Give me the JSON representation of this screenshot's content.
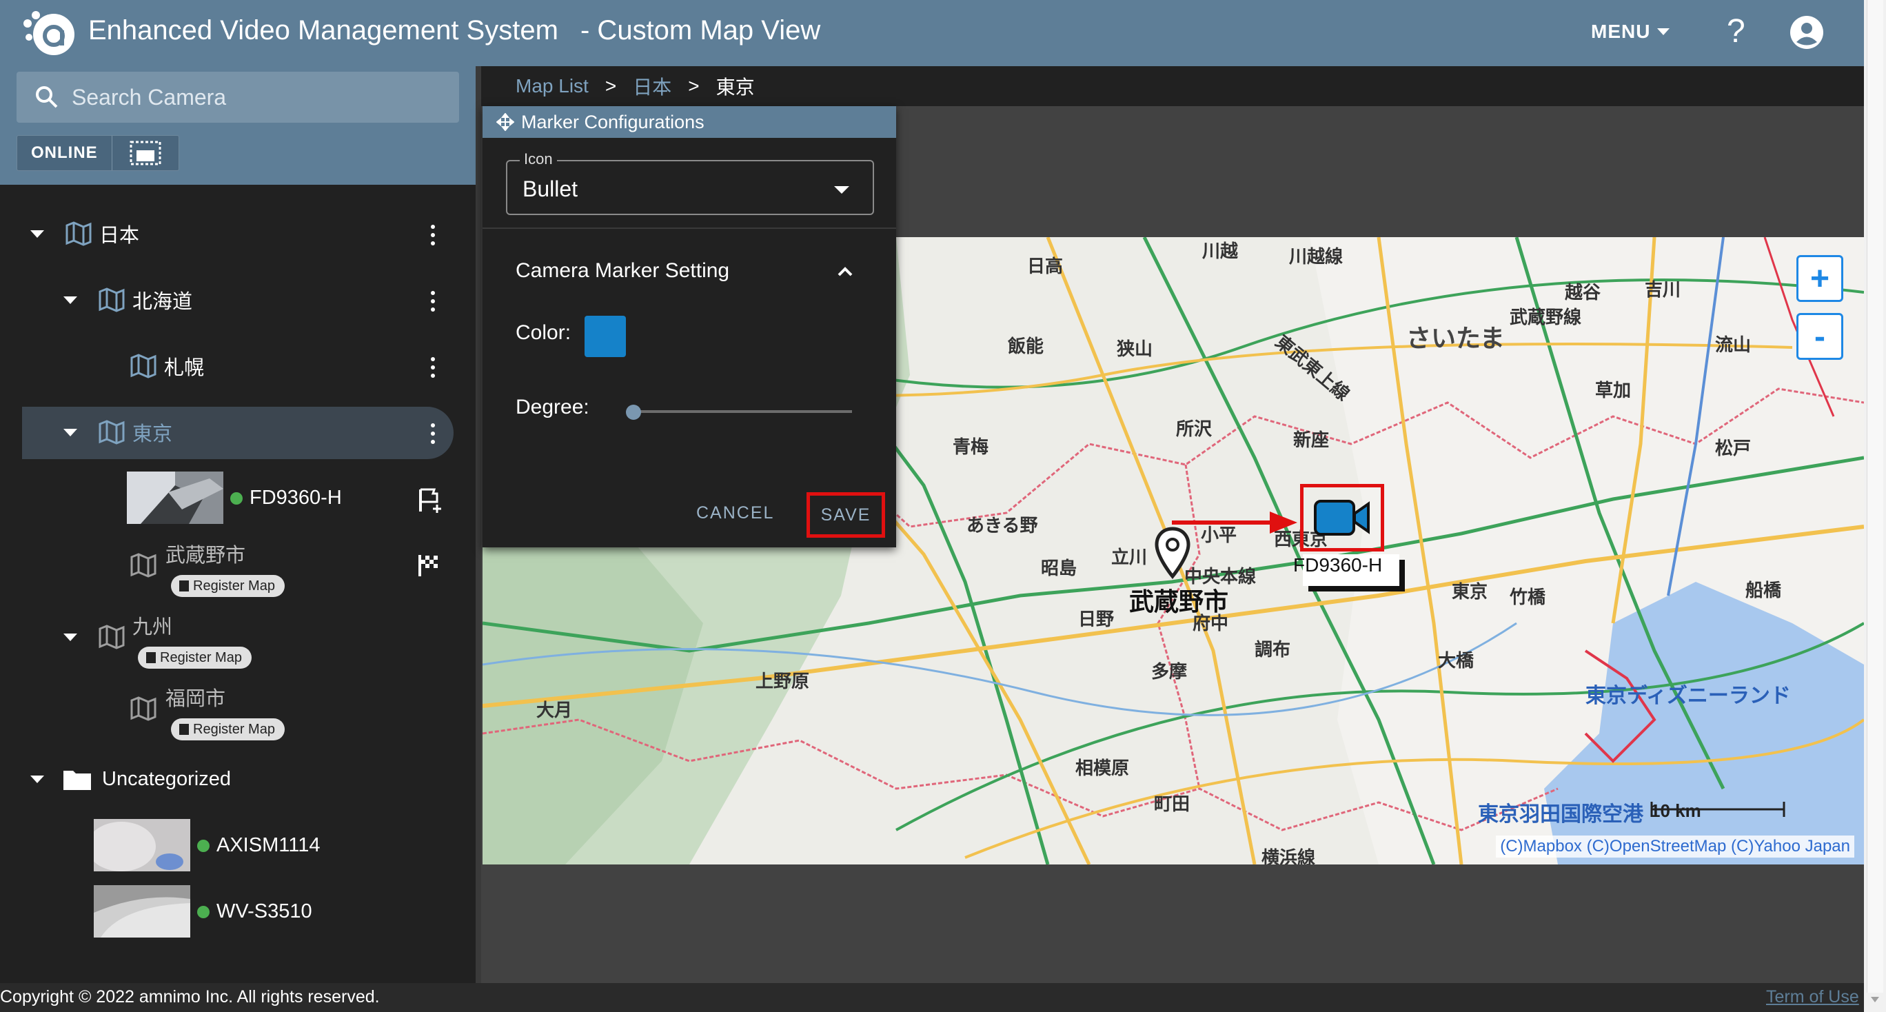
{
  "header": {
    "app_title": "Enhanced Video Management System",
    "view_title": "- Custom Map View",
    "menu_label": "MENU",
    "help_label": "?"
  },
  "sidebar": {
    "search_placeholder": "Search Camera",
    "filter_online": "ONLINE",
    "tree": {
      "japan": "日本",
      "hokkaido": "北海道",
      "sapporo": "札幌",
      "tokyo": "東京",
      "camera_fd9360": "FD9360-H",
      "musashino": "武蔵野市",
      "kyushu": "九州",
      "fukuoka": "福岡市",
      "uncategorized": "Uncategorized",
      "camera_axism1114": "AXISM1114",
      "camera_wvs3510": "WV-S3510",
      "register_map_label": "Register Map"
    }
  },
  "breadcrumb": {
    "map_list": "Map List",
    "sep": ">",
    "japan": "日本",
    "tokyo": "東京"
  },
  "dialog": {
    "title": "Marker Configurations",
    "icon_legend": "Icon",
    "icon_value": "Bullet",
    "section_title": "Camera Marker Setting",
    "color_label": "Color:",
    "color_value": "#1582c9",
    "degree_label": "Degree:",
    "degree_value": 0,
    "cancel_label": "CANCEL",
    "save_label": "SAVE"
  },
  "map": {
    "zoom_in": "+",
    "zoom_out": "-",
    "camera_marker_label": "FD9360-H",
    "pin_label": "武蔵野市",
    "labels": {
      "hidaka": "日高",
      "kawagoe": "川越",
      "koshigaya": "越谷",
      "yoshikawa": "吉川",
      "saitama": "さいたま",
      "hanno": "飯能",
      "sayama": "狭山",
      "nagareyama": "流山",
      "tokorozawa": "所沢",
      "soka": "草加",
      "ome": "青梅",
      "niiza": "新座",
      "matsudo": "松戸",
      "akiruno": "あきる野",
      "kodaira": "小平",
      "nishitokyo": "西東京",
      "akishima": "昭島",
      "tachikawa": "立川",
      "tokyo_city": "東京",
      "takenotsuka": "竹橋",
      "funabashi": "船橋",
      "hino": "日野",
      "fuchu": "府中",
      "chofu": "調布",
      "ohashi": "大橋",
      "tama": "多摩",
      "uenohara": "上野原",
      "otsuki": "大月",
      "disneyland": "東京ディズニーランド",
      "sagamihara": "相模原",
      "machida": "町田",
      "haneda": "東京羽田国際空港",
      "chuo_line": "中央本線",
      "musashino_line": "武蔵野線",
      "tobu_tojo": "東武東上線",
      "yokohama_line": "横浜線",
      "kawagoe_line": "川越線"
    },
    "scale_label": "10 km",
    "attribution": "(C)Mapbox (C)OpenStreetMap (C)Yahoo Japan"
  },
  "footer": {
    "copyright": "Copyright © 2022 amnimo Inc. All rights reserved.",
    "terms": "Term of Use"
  }
}
